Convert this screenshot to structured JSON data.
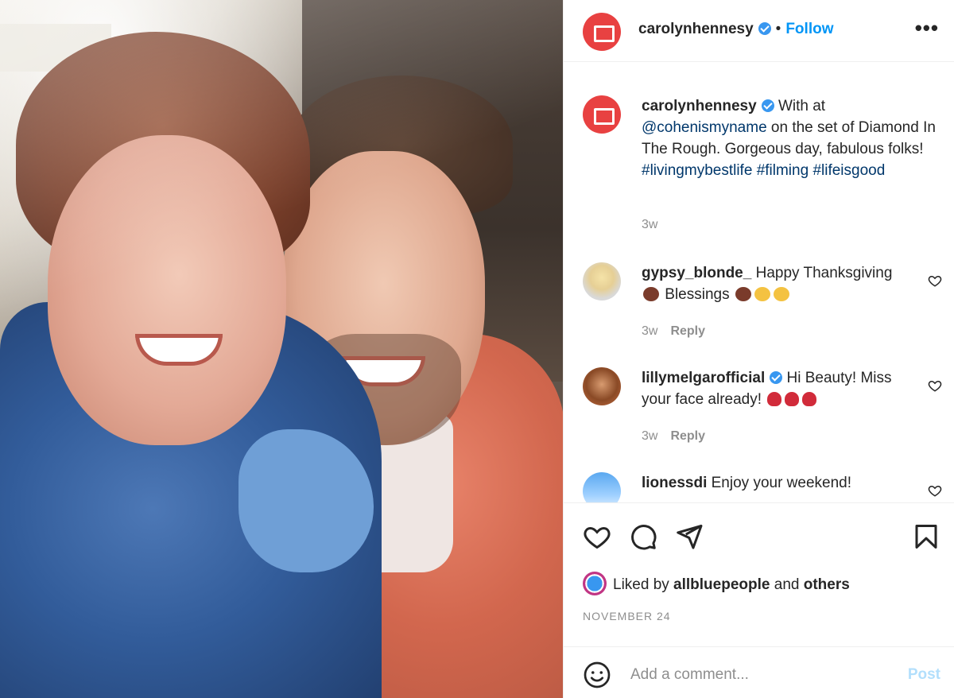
{
  "photo": {
    "alt": "Selfie of two people outdoors"
  },
  "header": {
    "username": "carolynhennesy",
    "separator": "•",
    "follow_label": "Follow",
    "more_label": "•••",
    "avatar_icon": "red-logo-icon"
  },
  "caption": {
    "username": "carolynhennesy",
    "text_1": " With at ",
    "mention": "@cohenismyname",
    "text_2": " on the set of Diamond In The Rough. Gorgeous day, fabulous folks! ",
    "hashtag_1": "#livingmybestlife",
    "hashtag_2": "#filming",
    "hashtag_3": "#lifeisgood",
    "time": "3w"
  },
  "comments": [
    {
      "username": "gypsy_blonde_",
      "text_1": " Happy Thanksgiving ",
      "text_2": " Blessings ",
      "time": "3w",
      "reply": "Reply"
    },
    {
      "username": "lillymelgarofficial",
      "text": " Hi Beauty! Miss your face already! ",
      "time": "3w",
      "reply": "Reply"
    },
    {
      "username": "lionessdi",
      "text": " Enjoy your weekend!"
    }
  ],
  "likes": {
    "prefix": "Liked by ",
    "user": "allbluepeople",
    "mid": " and ",
    "others": "others"
  },
  "date": "NOVEMBER 24",
  "comment_box": {
    "placeholder": "Add a comment...",
    "post_label": "Post"
  },
  "colors": {
    "accent": "#0095f6",
    "brand": "#e84141",
    "verified": "#3897f0"
  }
}
